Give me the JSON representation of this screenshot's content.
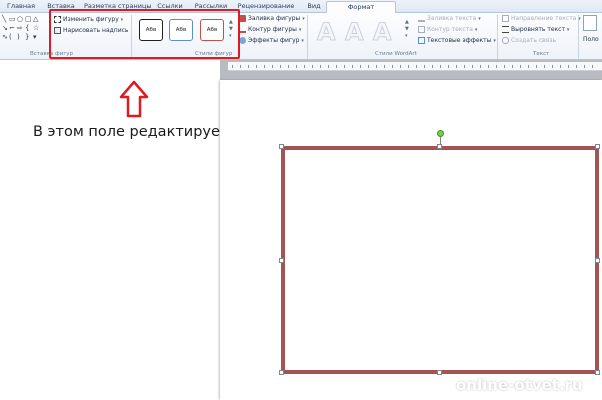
{
  "tabs": [
    "Главная",
    "Вставка",
    "Разметка страницы",
    "Ссылки",
    "Рассылки",
    "Рецензирование",
    "Вид",
    "Формат"
  ],
  "ribbon": {
    "insert_shapes": {
      "label": "Вставка фигур",
      "edit_shape": "Изменить фигуру",
      "draw_textbox": "Нарисовать надпись"
    },
    "shape_styles": {
      "label": "Стили фигур",
      "style_text": "Абв",
      "fill": "Заливка фигуры",
      "outline": "Контур фигуры",
      "effects": "Эффекты фигур"
    },
    "wordart": {
      "label": "Стили WordArt",
      "letter": "A",
      "text_fill": "Заливка текста",
      "text_outline": "Контур текста",
      "text_effects": "Текстовые эффекты"
    },
    "text": {
      "label": "Текст",
      "direction": "Направление текста",
      "align": "Выровнять текст",
      "link": "Создать связь"
    },
    "position": "Поло"
  },
  "caption": "В этом поле редактируется",
  "watermark": "online-otvet.ru",
  "colors": {
    "highlight": "#e01a22",
    "shape_outline": "#a35552",
    "style1": "#1f1f1f",
    "style2": "#5b8fcb",
    "style3": "#c0504d"
  }
}
